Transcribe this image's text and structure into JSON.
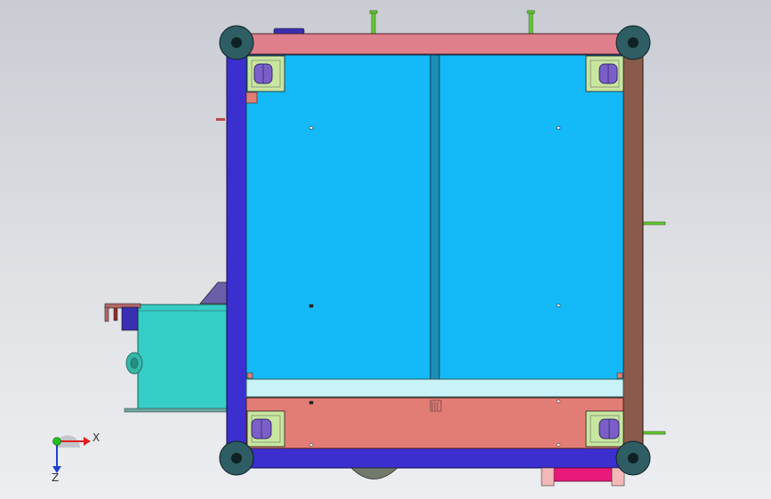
{
  "viewport": {
    "background": "#dfe1e5",
    "model": "cart-frame-assembly",
    "view": "top"
  },
  "colors": {
    "frame_left": "#3c2fd0",
    "frame_bottom": "#3c2fd0",
    "frame_top": "#e07f8c",
    "frame_right": "#8a5a4a",
    "panel": "#14b9f7",
    "lower_panel": "#e27d76",
    "light_strip": "#c9f3f6",
    "side_box": "#35cdc5",
    "caster_plate": "#c8e6a0",
    "caster_wheel": "#7b5fc9",
    "corner_wheel": "#2e5d63",
    "pins": "#66cc33"
  },
  "triad": {
    "x_label": "X",
    "z_label": "Z",
    "x_color": "#e02020",
    "y_color": "#20c020",
    "z_color": "#2040d0"
  }
}
